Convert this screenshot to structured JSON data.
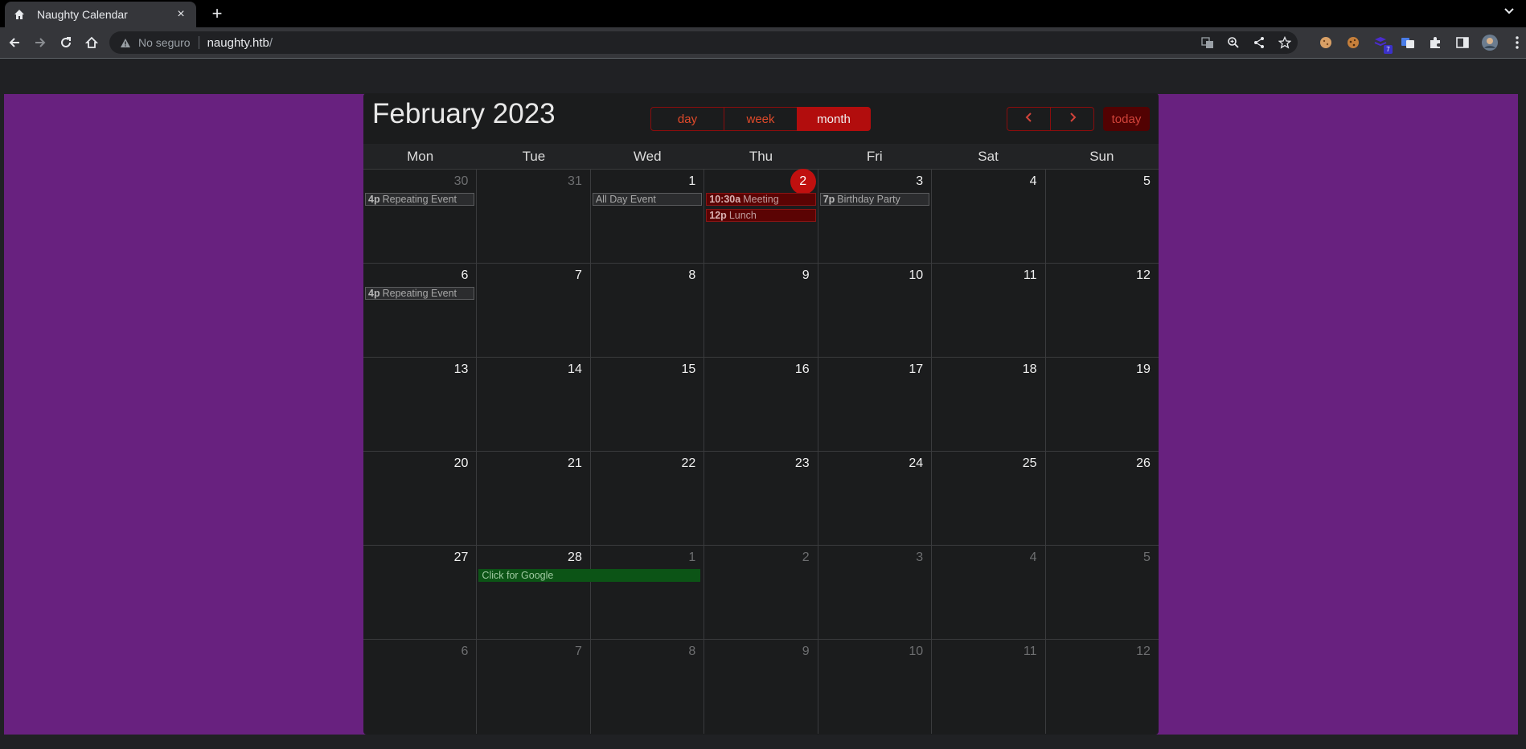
{
  "browser": {
    "tab_title": "Naughty Calendar",
    "tab_close": "×",
    "new_tab": "+",
    "security_label": "No seguro",
    "url_host": "naughty.htb",
    "url_path": "/",
    "extension_badge": "7"
  },
  "calendar": {
    "title": "February 2023",
    "views": {
      "day": "day",
      "week": "week",
      "month": "month"
    },
    "active_view": "month",
    "today_label": "today",
    "weekdays": [
      "Mon",
      "Tue",
      "Wed",
      "Thu",
      "Fri",
      "Sat",
      "Sun"
    ],
    "weeks": [
      [
        {
          "num": "30",
          "other": true,
          "events": [
            {
              "time": "4p",
              "title": "Repeating Event",
              "style": "grey"
            }
          ]
        },
        {
          "num": "31",
          "other": true,
          "events": []
        },
        {
          "num": "1",
          "events": [
            {
              "time": "",
              "title": "All Day Event",
              "style": "grey"
            }
          ]
        },
        {
          "num": "2",
          "today": true,
          "events": [
            {
              "time": "10:30a",
              "title": "Meeting",
              "style": "red"
            },
            {
              "time": "12p",
              "title": "Lunch",
              "style": "red"
            }
          ]
        },
        {
          "num": "3",
          "events": [
            {
              "time": "7p",
              "title": "Birthday Party",
              "style": "grey"
            }
          ]
        },
        {
          "num": "4",
          "events": []
        },
        {
          "num": "5",
          "events": []
        }
      ],
      [
        {
          "num": "6",
          "events": [
            {
              "time": "4p",
              "title": "Repeating Event",
              "style": "grey"
            }
          ]
        },
        {
          "num": "7",
          "events": []
        },
        {
          "num": "8",
          "events": []
        },
        {
          "num": "9",
          "events": []
        },
        {
          "num": "10",
          "events": []
        },
        {
          "num": "11",
          "events": []
        },
        {
          "num": "12",
          "events": []
        }
      ],
      [
        {
          "num": "13",
          "events": []
        },
        {
          "num": "14",
          "events": []
        },
        {
          "num": "15",
          "events": []
        },
        {
          "num": "16",
          "events": []
        },
        {
          "num": "17",
          "events": []
        },
        {
          "num": "18",
          "events": []
        },
        {
          "num": "19",
          "events": []
        }
      ],
      [
        {
          "num": "20",
          "events": []
        },
        {
          "num": "21",
          "events": []
        },
        {
          "num": "22",
          "events": []
        },
        {
          "num": "23",
          "events": []
        },
        {
          "num": "24",
          "events": []
        },
        {
          "num": "25",
          "events": []
        },
        {
          "num": "26",
          "events": []
        }
      ],
      [
        {
          "num": "27",
          "events": []
        },
        {
          "num": "28",
          "events": [
            {
              "time": "",
              "title": "Click for Google",
              "style": "green"
            }
          ]
        },
        {
          "num": "1",
          "other": true,
          "events": []
        },
        {
          "num": "2",
          "other": true,
          "events": []
        },
        {
          "num": "3",
          "other": true,
          "events": []
        },
        {
          "num": "4",
          "other": true,
          "events": []
        },
        {
          "num": "5",
          "other": true,
          "events": []
        }
      ],
      [
        {
          "num": "6",
          "other": true,
          "events": []
        },
        {
          "num": "7",
          "other": true,
          "events": []
        },
        {
          "num": "8",
          "other": true,
          "events": []
        },
        {
          "num": "9",
          "other": true,
          "events": []
        },
        {
          "num": "10",
          "other": true,
          "events": []
        },
        {
          "num": "11",
          "other": true,
          "events": []
        },
        {
          "num": "12",
          "other": true,
          "events": []
        }
      ]
    ]
  },
  "colors": {
    "accent_red": "#b20d0d",
    "page_purple": "#68217f",
    "calendar_bg": "#1b1c1d",
    "event_green": "#0c5416"
  }
}
